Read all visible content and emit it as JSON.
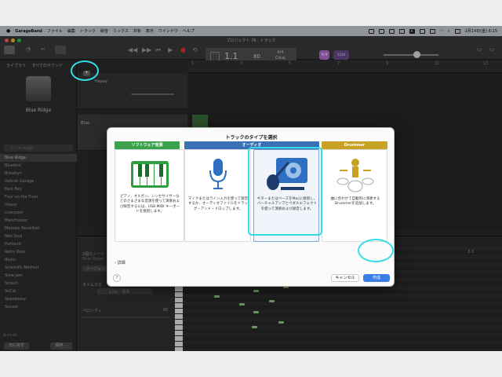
{
  "menubar": {
    "apple": "",
    "app": "GarageBand",
    "items": [
      "ファイル",
      "編集",
      "トラック",
      "録音",
      "ミックス",
      "共有",
      "表示",
      "ウインドウ",
      "ヘルプ"
    ],
    "clock": "2月14日(金) 6:15"
  },
  "toolbar": {
    "window_title": "プロジェクト 76 - トラック",
    "bar": "1.1",
    "tempo": "80",
    "time_signature": "4/4",
    "key": "Cmaj",
    "chip_label": "4/4",
    "chip2_label": "1234"
  },
  "library": {
    "header_library": "ライブラリ",
    "header_all": "すべてのサウンド",
    "selected_name": "Blue Ridge",
    "search_placeholder": "ドラマーを検索",
    "items": [
      "Blue Ridge",
      "Bluebird",
      "Brooklyn",
      "Detroit Garage",
      "East Bay",
      "Four on the Floor",
      "Heavy",
      "Liverpool",
      "Manchester",
      "Motown Revisited",
      "Neo Soul",
      "Portland",
      "Retro Rock",
      "Roots",
      "Scientific Method",
      "Slow Jam",
      "Smash",
      "SoCal",
      "Speakeasy",
      "Sunset"
    ],
    "footer": "Drum Kit",
    "delete_button": "元に戻す",
    "save_button": "保存..."
  },
  "tracks": [
    {
      "name": "Heavy"
    },
    {
      "name": "Blue"
    }
  ],
  "ruler": {
    "marks": [
      "1",
      "3",
      "5",
      "7",
      "9",
      "11",
      "13",
      "15"
    ]
  },
  "editor": {
    "label1": "1個のノート",
    "label2": "Blue Ridge",
    "label3": "リージョン",
    "label4": "タイムクオ",
    "field": "1/16 - 標準",
    "label5": "ベロシティ",
    "velocity": "80",
    "ruler_value": "3.3"
  },
  "dialog": {
    "title": "トラックのタイプを選択",
    "categories": [
      {
        "label": "ソフトウェア音源",
        "color": "#3aa24b",
        "description": "ピアノ、オルガン、シンセサイザーなどのさまざまな音源を使って演奏および録音するには、USB MIDI キーボードを接続します。"
      },
      {
        "label": "オーディオ",
        "color": "#3b6fb6",
        "description": "マイクまたはライン入力を使って録音するか、オーディオファイルをドラッグ・アンド・ドロップします。"
      },
      {
        "label": "オーディオ",
        "color": "#3b6fb6",
        "description": "ギターまたはベースをMacに接続し、バーチャルアンプとペダルエフェクトを使って演奏および録音します。"
      },
      {
        "label": "Drummer",
        "color": "#c8a224",
        "description": "曲に合わせて自動的に演奏するDrummerを追加します。"
      }
    ],
    "details_label": "詳細",
    "help_label": "?",
    "cancel_label": "キャンセル",
    "create_label": "作成"
  },
  "colors": {
    "highlight": "#34dde6",
    "primary_button": "#3a7ee6"
  }
}
